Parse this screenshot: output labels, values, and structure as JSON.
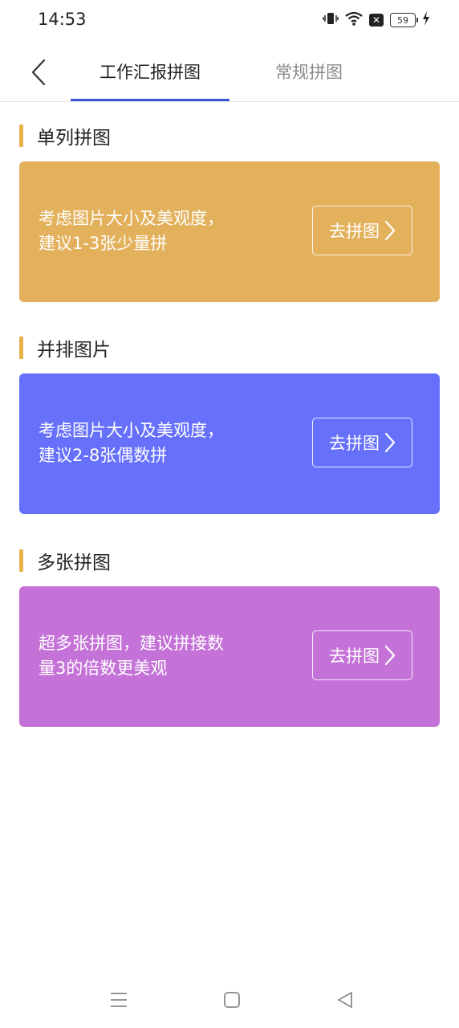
{
  "status_bar": {
    "time": "14:53",
    "battery": "59",
    "icons": [
      "vibrate-icon",
      "wifi-icon",
      "notification-x-icon",
      "battery-icon",
      "charging-icon"
    ]
  },
  "nav": {
    "tabs": [
      {
        "label": "工作汇报拼图",
        "active": true
      },
      {
        "label": "常规拼图",
        "active": false
      }
    ],
    "accent_color": "#3a55d8"
  },
  "sections": [
    {
      "title": "单列拼图",
      "description": "考虑图片大小及美观度，建议1-3张少量拼",
      "button_label": "去拼图",
      "color": "#e3b15c"
    },
    {
      "title": "并排图片",
      "description": "考虑图片大小及美观度，建议2-8张偶数拼",
      "button_label": "去拼图",
      "color": "#6670fb"
    },
    {
      "title": "多张拼图",
      "description": "超多张拼图，建议拼接数量3的倍数更美观",
      "button_label": "去拼图",
      "color": "#c472d7"
    }
  ],
  "section_bar_color": "#e8b24a"
}
